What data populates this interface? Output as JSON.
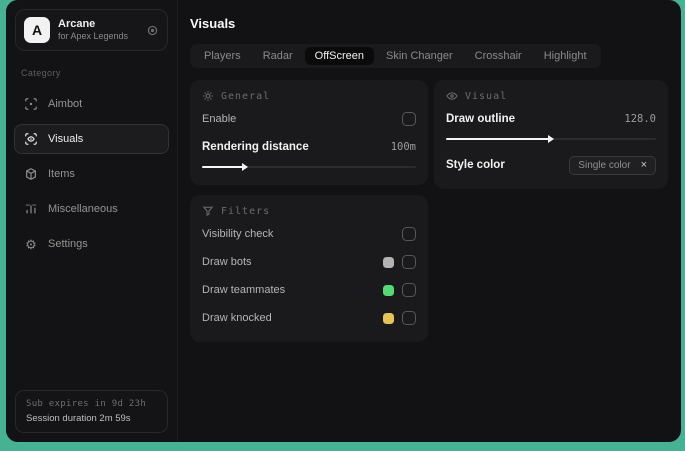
{
  "sidebar": {
    "logo_letter": "A",
    "app_name": "Arcane",
    "app_subtitle": "for Apex Legends",
    "category_label": "Category",
    "items": [
      {
        "label": "Aimbot",
        "icon": "crosshair-target",
        "active": false
      },
      {
        "label": "Visuals",
        "icon": "eye-scan",
        "active": true
      },
      {
        "label": "Items",
        "icon": "box",
        "active": false
      },
      {
        "label": "Miscellaneous",
        "icon": "bars",
        "active": false
      },
      {
        "label": "Settings",
        "icon": "gear",
        "active": false
      }
    ],
    "footer": {
      "line1": "Sub expires in 9d 23h",
      "line2": "Session duration 2m 59s"
    }
  },
  "main": {
    "title": "Visuals",
    "tabs": [
      {
        "label": "Players",
        "active": false
      },
      {
        "label": "Radar",
        "active": false
      },
      {
        "label": "OffScreen",
        "active": true
      },
      {
        "label": "Skin Changer",
        "active": false
      },
      {
        "label": "Crosshair",
        "active": false
      },
      {
        "label": "Highlight",
        "active": false
      }
    ],
    "panels": {
      "general": {
        "title": "General",
        "enable": {
          "label": "Enable",
          "checked": false
        },
        "rendering_distance": {
          "label": "Rendering distance",
          "value": "100m",
          "slider_pct": 19
        }
      },
      "visual": {
        "title": "Visual",
        "draw_outline": {
          "label": "Draw outline",
          "value": "128.0",
          "slider_pct": 49
        },
        "style_color": {
          "label": "Style color",
          "chip_label": "Single color",
          "chip_close": "×"
        }
      },
      "filters": {
        "title": "Filters",
        "rows": [
          {
            "label": "Visibility check",
            "swatch": null,
            "checked": false
          },
          {
            "label": "Draw bots",
            "swatch": "#b3b3b3",
            "checked": false
          },
          {
            "label": "Draw teammates",
            "swatch": "#55d973",
            "checked": false
          },
          {
            "label": "Draw knocked",
            "swatch": "#e3c455",
            "checked": false
          }
        ]
      }
    }
  },
  "colors": {
    "desktop_teal": "#47b194",
    "window_bg": "#121214",
    "panel_bg": "#1a1a1c"
  }
}
